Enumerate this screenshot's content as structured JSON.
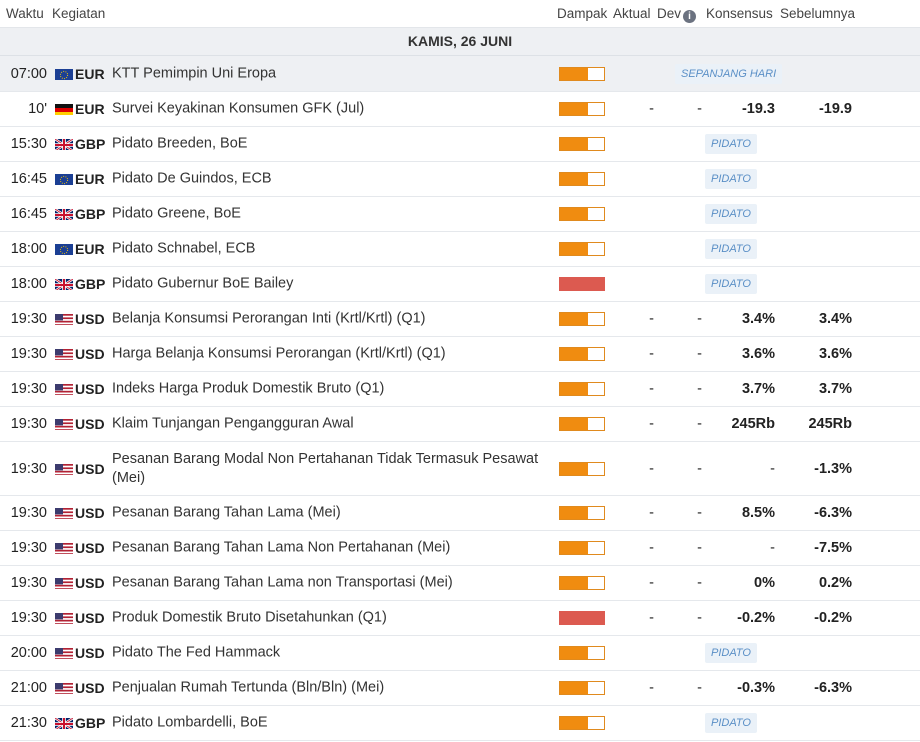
{
  "header": {
    "time": "Waktu",
    "activity": "Kegiatan",
    "impact": "Dampak",
    "actual": "Aktual",
    "dev": "Dev",
    "consensus": "Konsensus",
    "previous": "Sebelumnya"
  },
  "day_label": "KAMIS, 26 JUNI",
  "colors": {
    "medium_impact": "#f08c10",
    "high_impact": "#dc5a50",
    "badge_text": "#5a8fc6"
  },
  "events": [
    {
      "time": "07:00",
      "currency": "EUR",
      "flag": "eu-flag",
      "event": "KTT Pemimpin Uni Eropa",
      "impact": "medium",
      "badge": "SEPANJANG HARI",
      "highlighted": true
    },
    {
      "time": "10'",
      "currency": "EUR",
      "flag": "de-flag",
      "event": "Survei Keyakinan Konsumen GFK (Jul)",
      "impact": "medium",
      "actual": "-",
      "dev": "-",
      "consensus": "-19.3",
      "previous": "-19.9"
    },
    {
      "time": "15:30",
      "currency": "GBP",
      "flag": "uk-flag",
      "event": "Pidato Breeden, BoE",
      "impact": "medium",
      "badge": "PIDATO"
    },
    {
      "time": "16:45",
      "currency": "EUR",
      "flag": "eu-flag",
      "event": "Pidato De Guindos, ECB",
      "impact": "medium",
      "badge": "PIDATO"
    },
    {
      "time": "16:45",
      "currency": "GBP",
      "flag": "uk-flag",
      "event": "Pidato Greene, BoE",
      "impact": "medium",
      "badge": "PIDATO"
    },
    {
      "time": "18:00",
      "currency": "EUR",
      "flag": "eu-flag",
      "event": "Pidato Schnabel, ECB",
      "impact": "medium",
      "badge": "PIDATO"
    },
    {
      "time": "18:00",
      "currency": "GBP",
      "flag": "uk-flag",
      "event": "Pidato Gubernur BoE Bailey",
      "impact": "high",
      "badge": "PIDATO"
    },
    {
      "time": "19:30",
      "currency": "USD",
      "flag": "us-flag",
      "event": "Belanja Konsumsi Perorangan Inti (Krtl/Krtl) (Q1)",
      "impact": "medium",
      "actual": "-",
      "dev": "-",
      "consensus": "3.4%",
      "previous": "3.4%"
    },
    {
      "time": "19:30",
      "currency": "USD",
      "flag": "us-flag",
      "event": "Harga Belanja Konsumsi Perorangan (Krtl/Krtl) (Q1)",
      "impact": "medium",
      "actual": "-",
      "dev": "-",
      "consensus": "3.6%",
      "previous": "3.6%"
    },
    {
      "time": "19:30",
      "currency": "USD",
      "flag": "us-flag",
      "event": "Indeks Harga Produk Domestik Bruto (Q1)",
      "impact": "medium",
      "actual": "-",
      "dev": "-",
      "consensus": "3.7%",
      "previous": "3.7%"
    },
    {
      "time": "19:30",
      "currency": "USD",
      "flag": "us-flag",
      "event": "Klaim Tunjangan Pengangguran Awal",
      "impact": "medium",
      "actual": "-",
      "dev": "-",
      "consensus": "245Rb",
      "previous": "245Rb"
    },
    {
      "time": "19:30",
      "currency": "USD",
      "flag": "us-flag",
      "event": "Pesanan Barang Modal Non Pertahanan Tidak Termasuk Pesawat (Mei)",
      "impact": "medium",
      "actual": "-",
      "dev": "-",
      "consensus": "-",
      "previous": "-1.3%"
    },
    {
      "time": "19:30",
      "currency": "USD",
      "flag": "us-flag",
      "event": "Pesanan Barang Tahan Lama (Mei)",
      "impact": "medium",
      "actual": "-",
      "dev": "-",
      "consensus": "8.5%",
      "previous": "-6.3%"
    },
    {
      "time": "19:30",
      "currency": "USD",
      "flag": "us-flag",
      "event": "Pesanan Barang Tahan Lama Non Pertahanan (Mei)",
      "impact": "medium",
      "actual": "-",
      "dev": "-",
      "consensus": "-",
      "previous": "-7.5%"
    },
    {
      "time": "19:30",
      "currency": "USD",
      "flag": "us-flag",
      "event": "Pesanan Barang Tahan Lama non Transportasi (Mei)",
      "impact": "medium",
      "actual": "-",
      "dev": "-",
      "consensus": "0%",
      "previous": "0.2%"
    },
    {
      "time": "19:30",
      "currency": "USD",
      "flag": "us-flag",
      "event": "Produk Domestik Bruto Disetahunkan (Q1)",
      "impact": "high",
      "actual": "-",
      "dev": "-",
      "consensus": "-0.2%",
      "previous": "-0.2%"
    },
    {
      "time": "20:00",
      "currency": "USD",
      "flag": "us-flag",
      "event": "Pidato The Fed Hammack",
      "impact": "medium",
      "badge": "PIDATO"
    },
    {
      "time": "21:00",
      "currency": "USD",
      "flag": "us-flag",
      "event": "Penjualan Rumah Tertunda (Bln/Bln) (Mei)",
      "impact": "medium",
      "actual": "-",
      "dev": "-",
      "consensus": "-0.3%",
      "previous": "-6.3%"
    },
    {
      "time": "21:30",
      "currency": "GBP",
      "flag": "uk-flag",
      "event": "Pidato Lombardelli, BoE",
      "impact": "medium",
      "badge": "PIDATO"
    }
  ]
}
